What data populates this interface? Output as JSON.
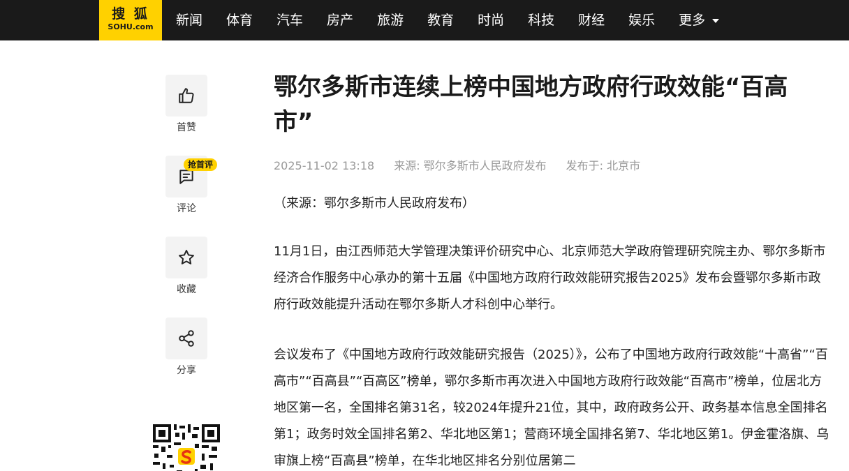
{
  "header": {
    "logo_cn": "搜 狐",
    "logo_en": "SOHU.com",
    "nav": [
      "新闻",
      "体育",
      "汽车",
      "房产",
      "旅游",
      "教育",
      "时尚",
      "科技",
      "财经",
      "娱乐"
    ],
    "more_label": "更多"
  },
  "sidebar": {
    "like_label": "首赞",
    "comment_label": "评论",
    "comment_badge": "抢首评",
    "favorite_label": "收藏",
    "share_label": "分享"
  },
  "colors": {
    "brand_yellow": "#ffd100",
    "topbar": "#1a1a1a",
    "meta_gray": "#999999"
  },
  "article": {
    "title": "鄂尔多斯市连续上榜中国地方政府行政效能“百高市”",
    "date": "2025-11-02 13:18",
    "source": "来源: 鄂尔多斯市人民政府发布",
    "published_at": "发布于: 北京市",
    "source_line": "（来源：鄂尔多斯市人民政府发布）",
    "paragraphs": [
      "11月1日，由江西师范大学管理决策评价研究中心、北京师范大学政府管理研究院主办、鄂尔多斯市经济合作服务中心承办的第十五届《中国地方政府行政效能研究报告2025》发布会暨鄂尔多斯市政府行政效能提升活动在鄂尔多斯人才科创中心举行。",
      "会议发布了《中国地方政府行政效能研究报告（2025）》，公布了中国地方政府行政效能“十高省”“百高市”“百高县”“百高区”榜单，鄂尔多斯市再次进入中国地方政府行政效能“百高市”榜单，位居北方地区第一名，全国排名第31名，较2024年提升21位，其中，政府政务公开、政务基本信息全国排名第1；政务时效全国排名第2、华北地区第1；营商环境全国排名第7、华北地区第1。伊金霍洛旗、乌审旗上榜“百高县”榜单，在华北地区排名分别位居第二"
    ]
  }
}
